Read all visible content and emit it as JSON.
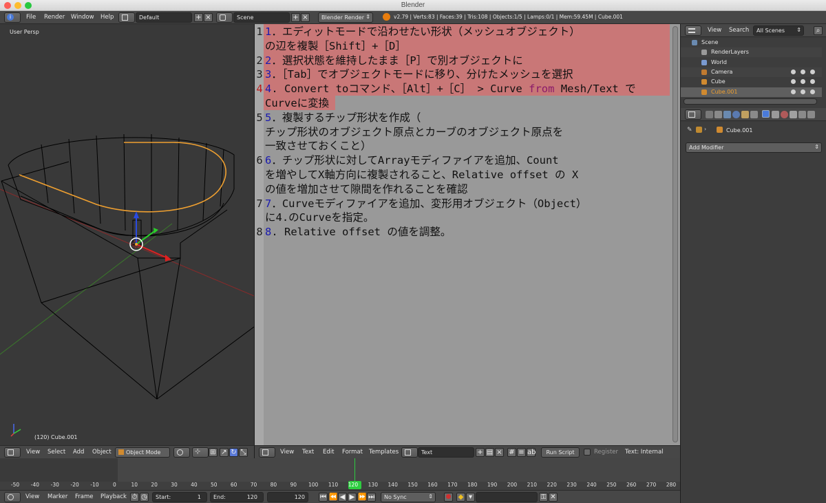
{
  "window": {
    "title": "Blender"
  },
  "info_header": {
    "menus": [
      "File",
      "Render",
      "Window",
      "Help"
    ],
    "screen_layout": "Default",
    "scene": "Scene",
    "render_engine": "Blender Render",
    "stats": "v2.79 | Verts:83 | Faces:39 | Tris:108 | Objects:1/5 | Lamps:0/1 | Mem:59.45M | Cube.001"
  },
  "viewport": {
    "view_label": "User Persp",
    "object_label": "(120) Cube.001",
    "header_menus": [
      "View",
      "Select",
      "Add",
      "Object"
    ],
    "mode": "Object Mode"
  },
  "text_editor": {
    "lines": [
      {
        "no": "1",
        "parts": [
          {
            "t": "1",
            "c": "num"
          },
          {
            "t": "．エディットモードで沿わせたい形状（メッシュオブジェクト）",
            "c": ""
          }
        ]
      },
      {
        "no": "",
        "parts": [
          {
            "t": "の辺を複製［Shift］+［D］",
            "c": ""
          }
        ]
      },
      {
        "no": "2",
        "parts": [
          {
            "t": "2",
            "c": "num"
          },
          {
            "t": "．選択状態を維持したまま［P］で別オブジェクトに",
            "c": ""
          }
        ]
      },
      {
        "no": "3",
        "parts": [
          {
            "t": "3",
            "c": "num"
          },
          {
            "t": "．［Tab］でオブジェクトモードに移り、分けたメッシュを選択",
            "c": ""
          }
        ]
      },
      {
        "no": "4",
        "parts": [
          {
            "t": "4",
            "c": "num"
          },
          {
            "t": ". Convert toコマンド、［Alt］+［C］ > Curve ",
            "c": ""
          },
          {
            "t": "from",
            "c": "kw"
          },
          {
            "t": " Mesh/Text で",
            "c": ""
          }
        ]
      },
      {
        "no": "",
        "parts": [
          {
            "t": "Curveに変換",
            "c": ""
          }
        ]
      },
      {
        "no": "5",
        "parts": [
          {
            "t": "5",
            "c": "num"
          },
          {
            "t": "．複製するチップ形状を作成（",
            "c": ""
          }
        ]
      },
      {
        "no": "",
        "parts": [
          {
            "t": "チップ形状のオブジェクト原点とカーブのオブジェクト原点を",
            "c": ""
          }
        ]
      },
      {
        "no": "",
        "parts": [
          {
            "t": "一致させておくこと）",
            "c": ""
          }
        ]
      },
      {
        "no": "6",
        "parts": [
          {
            "t": "6",
            "c": "num"
          },
          {
            "t": "．チップ形状に対してArrayモディファイアを追加、Count",
            "c": ""
          }
        ]
      },
      {
        "no": "",
        "parts": [
          {
            "t": "を増やしてX軸方向に複製されること、Relative offset の X",
            "c": ""
          }
        ]
      },
      {
        "no": "",
        "parts": [
          {
            "t": "の値を増加させて隙間を作れることを確認",
            "c": ""
          }
        ]
      },
      {
        "no": "7",
        "parts": [
          {
            "t": "7",
            "c": "num"
          },
          {
            "t": "．Curveモディファイアを追加、変形用オブジェクト（Object）",
            "c": ""
          }
        ]
      },
      {
        "no": "",
        "parts": [
          {
            "t": "に4.のCurveを指定。",
            "c": ""
          }
        ]
      },
      {
        "no": "8",
        "parts": [
          {
            "t": "8",
            "c": "num"
          },
          {
            "t": ". Relative offset の値を調整。",
            "c": ""
          }
        ]
      }
    ],
    "header_menus": [
      "View",
      "Text",
      "Edit",
      "Format",
      "Templates"
    ],
    "datablock": "Text",
    "run_script": "Run Script",
    "register": "Register",
    "status": "Text: Internal"
  },
  "outliner": {
    "header_menus": [
      "View",
      "Search"
    ],
    "filter": "All Scenes",
    "items": [
      {
        "label": "Scene",
        "indent": 0
      },
      {
        "label": "RenderLayers",
        "indent": 1
      },
      {
        "label": "World",
        "indent": 1
      },
      {
        "label": "Camera",
        "indent": 1
      },
      {
        "label": "Cube",
        "indent": 1
      },
      {
        "label": "Cube.001",
        "indent": 1
      }
    ]
  },
  "properties": {
    "object_name": "Cube.001",
    "add_modifier": "Add Modifier"
  },
  "timeline": {
    "ticks": [
      "-50",
      "-40",
      "-30",
      "-20",
      "-10",
      "0",
      "10",
      "20",
      "30",
      "40",
      "50",
      "60",
      "70",
      "80",
      "90",
      "100",
      "110",
      "120",
      "130",
      "140",
      "150",
      "160",
      "170",
      "180",
      "190",
      "200",
      "210",
      "220",
      "230",
      "240",
      "250",
      "260",
      "270",
      "280"
    ],
    "current_frame": 120,
    "footer_menus": [
      "View",
      "Marker",
      "Frame",
      "Playback"
    ],
    "start_label": "Start:",
    "start_value": "1",
    "end_label": "End:",
    "end_value": "120",
    "current_value": "120",
    "sync": "No Sync"
  },
  "colors": {
    "selection": "#c97777",
    "line_number": "#1a1ab0",
    "keyword": "#8a1a6a",
    "editor_bg": "#999999",
    "playhead": "#2ecc40"
  }
}
